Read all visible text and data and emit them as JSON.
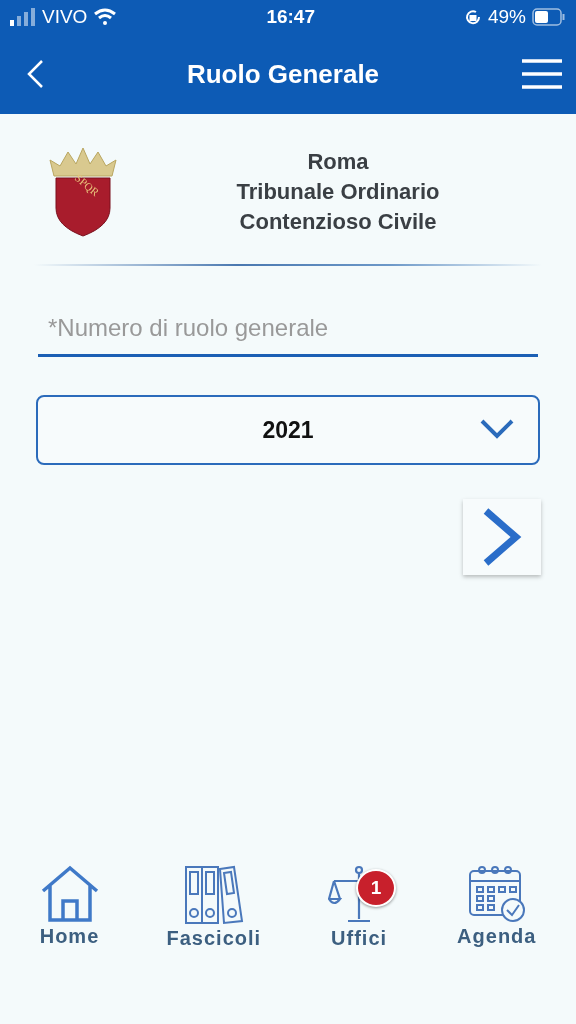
{
  "status_bar": {
    "carrier": "VIVO",
    "time": "16:47",
    "battery": "49%"
  },
  "header": {
    "title": "Ruolo Generale"
  },
  "office": {
    "emblem_text": "SPQR",
    "lines": [
      "Roma",
      "Tribunale Ordinario",
      "Contenzioso Civile"
    ]
  },
  "form": {
    "number_field": {
      "placeholder": "*Numero di ruolo generale"
    },
    "year_select": {
      "value": "2021"
    }
  },
  "bottom_nav": [
    {
      "kind": "home",
      "label": "Home"
    },
    {
      "kind": "folders",
      "label": "Fascicoli"
    },
    {
      "kind": "scales",
      "label": "Uffici",
      "badge": "1"
    },
    {
      "kind": "calendar",
      "label": "Agenda"
    }
  ]
}
